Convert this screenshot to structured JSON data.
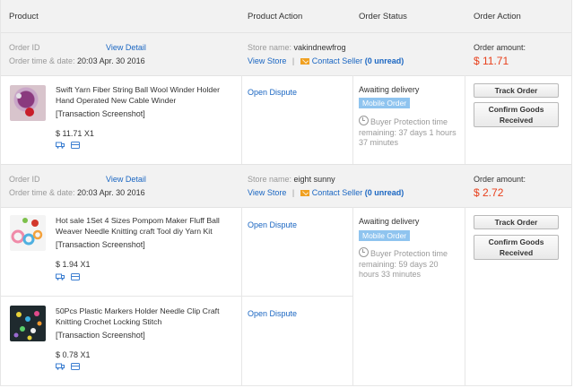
{
  "header": {
    "product": "Product",
    "product_action": "Product Action",
    "order_status": "Order Status",
    "order_action": "Order Action"
  },
  "orders": [
    {
      "order_id_label": "Order ID",
      "view_detail": "View Detail",
      "time_label": "Order time & date:",
      "time_value": "20:03 Apr. 30 2016",
      "store_label": "Store name:",
      "store_name": "vakindnewfrog",
      "view_store": "View Store",
      "separator": "|",
      "contact_seller": "Contact Seller",
      "unread": "(0 unread)",
      "amount_label": "Order amount:",
      "amount_value": "$ 11.71",
      "status": "Awaiting delivery",
      "mobile_badge": "Mobile Order",
      "protection_l1": "Buyer Protection time",
      "protection_l2": "remaining: 37 days 1 hours",
      "protection_l3": "37 minutes",
      "track_button": "Track Order",
      "confirm_l1": "Confirm Goods",
      "confirm_l2": "Received",
      "items": [
        {
          "name": "Swift Yarn Fiber String Ball Wool Winder Holder Hand Operated New Cable Winder",
          "screenshot": "[Transaction Screenshot]",
          "price": "$ 11.71 X1",
          "action": "Open Dispute"
        }
      ]
    },
    {
      "order_id_label": "Order ID",
      "view_detail": "View Detail",
      "time_label": "Order time & date:",
      "time_value": "20:03 Apr. 30 2016",
      "store_label": "Store name:",
      "store_name": "eight sunny",
      "view_store": "View Store",
      "separator": "|",
      "contact_seller": "Contact Seller",
      "unread": "(0 unread)",
      "amount_label": "Order amount:",
      "amount_value": "$ 2.72",
      "status": "Awaiting delivery",
      "mobile_badge": "Mobile Order",
      "protection_l1": "Buyer Protection time",
      "protection_l2": "remaining: 59 days 20",
      "protection_l3": "hours 33 minutes",
      "track_button": "Track Order",
      "confirm_l1": "Confirm Goods",
      "confirm_l2": "Received",
      "items": [
        {
          "name": "Hot sale 1Set 4 Sizes Pompom Maker Fluff Ball Weaver Needle Knitting craft Tool diy Yarn Kit",
          "screenshot": "[Transaction Screenshot]",
          "price": "$ 1.94 X1",
          "action": "Open Dispute"
        },
        {
          "name": "50Pcs Plastic Markers Holder Needle Clip Craft Knitting Crochet Locking Stitch",
          "screenshot": "[Transaction Screenshot]",
          "price": "$ 0.78 X1",
          "action": "Open Dispute"
        }
      ]
    }
  ],
  "icons": [
    "truck-icon",
    "cart-icon",
    "clock-icon",
    "mail-icon"
  ],
  "colors": {
    "link": "#1a66c2",
    "amount": "#e8401c",
    "badge": "#8fc4ef",
    "header_bg": "#f2f2f2"
  }
}
